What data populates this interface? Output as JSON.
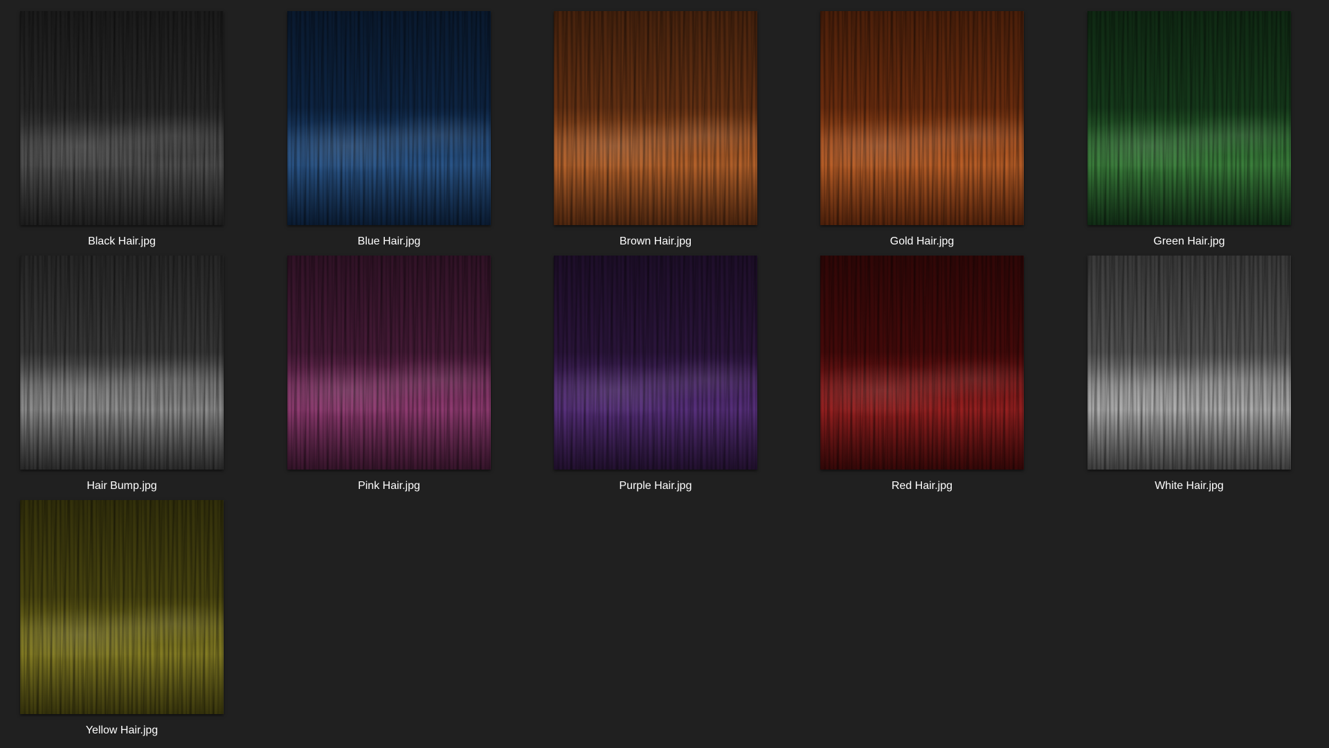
{
  "files": [
    {
      "name": "Black Hair.jpg",
      "base": "#2a2a2a",
      "highlight": "#565656",
      "icon": "image-thumbnail"
    },
    {
      "name": "Blue Hair.jpg",
      "base": "#0e2748",
      "highlight": "#2d5c94",
      "icon": "image-thumbnail"
    },
    {
      "name": "Brown Hair.jpg",
      "base": "#6e3514",
      "highlight": "#c46a2e",
      "icon": "image-thumbnail"
    },
    {
      "name": "Gold Hair.jpg",
      "base": "#74300f",
      "highlight": "#c9662a",
      "icon": "image-thumbnail"
    },
    {
      "name": "Green Hair.jpg",
      "base": "#173f1d",
      "highlight": "#3f8a40",
      "icon": "image-thumbnail"
    },
    {
      "name": "Hair Bump.jpg",
      "base": "#3c3c3c",
      "highlight": "#9a9a9a",
      "icon": "image-thumbnail"
    },
    {
      "name": "Pink Hair.jpg",
      "base": "#4b1c3b",
      "highlight": "#9b3f7a",
      "icon": "image-thumbnail"
    },
    {
      "name": "Purple Hair.jpg",
      "base": "#2e1640",
      "highlight": "#5e3386",
      "icon": "image-thumbnail"
    },
    {
      "name": "Red Hair.jpg",
      "base": "#4a0a0a",
      "highlight": "#a32222",
      "icon": "image-thumbnail"
    },
    {
      "name": "White Hair.jpg",
      "base": "#5a5a5a",
      "highlight": "#bdbdbd",
      "icon": "image-thumbnail"
    },
    {
      "name": "Yellow Hair.jpg",
      "base": "#4e4a10",
      "highlight": "#8e8626",
      "icon": "image-thumbnail"
    }
  ]
}
